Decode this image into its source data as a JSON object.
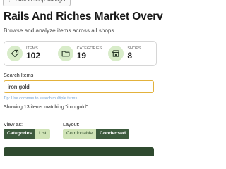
{
  "back_button": {
    "label": "Back to Shop Manager",
    "icon": "arrow-left-icon"
  },
  "header": {
    "title": "Rails And Riches Market Overv",
    "subtitle": "Browse and analyze items across all shops."
  },
  "stats": [
    {
      "label": "ITEMS",
      "value": "102",
      "icon": "tag-icon"
    },
    {
      "label": "CATEGORIES",
      "value": "19",
      "icon": "folder-icon"
    },
    {
      "label": "SHOPS",
      "value": "8",
      "icon": "shop-icon"
    }
  ],
  "search": {
    "label": "Search Items",
    "value": "iron,gold",
    "tip": "Tip: Use commas to search multiple terms",
    "result_text": "Showing 13 items matching \"iron,gold\""
  },
  "view_as": {
    "label": "View as:",
    "options": [
      "Categories",
      "List"
    ],
    "selected": "Categories"
  },
  "layout": {
    "label": "Layout:",
    "options": [
      "Comfortable",
      "Condensed"
    ],
    "selected": "Comfortable"
  },
  "colors": {
    "accent_dark": "#3c5a3c",
    "accent_light": "#cfe3b6",
    "focus_border": "#e3b23c"
  }
}
